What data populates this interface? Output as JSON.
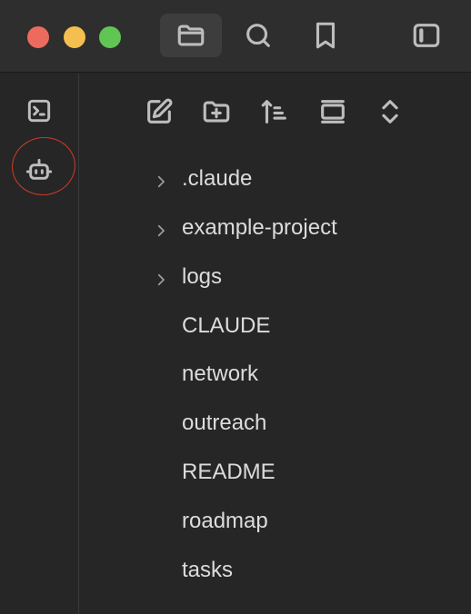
{
  "titlebar": {
    "icons": [
      "folder-icon",
      "search-icon",
      "bookmark-icon",
      "sidebar-toggle-icon"
    ]
  },
  "ribbon": {
    "icons": [
      "terminal-icon",
      "bot-icon"
    ]
  },
  "explorer": {
    "toolbar_icons": [
      "new-note-icon",
      "new-folder-icon",
      "sort-icon",
      "collapse-all-icon",
      "expand-icon"
    ],
    "folders": [
      {
        "label": ".claude"
      },
      {
        "label": "example-project"
      },
      {
        "label": "logs"
      }
    ],
    "files": [
      {
        "label": "CLAUDE"
      },
      {
        "label": "network"
      },
      {
        "label": "outreach"
      },
      {
        "label": "README"
      },
      {
        "label": "roadmap"
      },
      {
        "label": "tasks"
      }
    ]
  },
  "colors": {
    "background": "#262626",
    "titlebar": "#2e2e2e",
    "annotation": "#d33a2c",
    "close": "#ed6a5e",
    "minimize": "#f5bf4f",
    "zoom": "#61c554"
  }
}
